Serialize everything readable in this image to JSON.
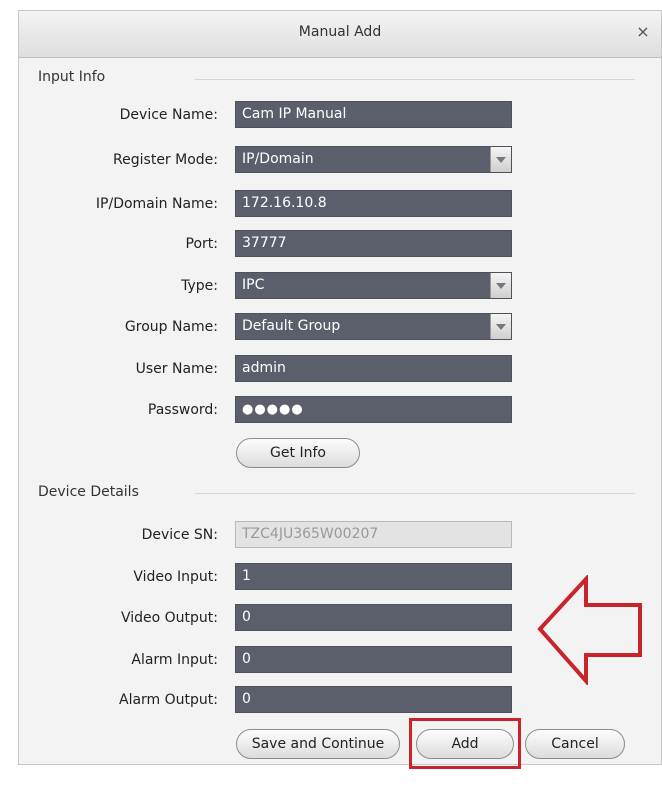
{
  "dialog": {
    "title": "Manual Add",
    "close_glyph": "×"
  },
  "sections": {
    "input_info": "Input Info",
    "device_details": "Device Details"
  },
  "input_info": {
    "device_name": {
      "label": "Device Name:",
      "value": "Cam IP Manual"
    },
    "register_mode": {
      "label": "Register Mode:",
      "value": "IP/Domain"
    },
    "ip_domain_name": {
      "label": "IP/Domain Name:",
      "value": "172.16.10.8"
    },
    "port": {
      "label": "Port:",
      "value": "37777"
    },
    "type": {
      "label": "Type:",
      "value": "IPC"
    },
    "group_name": {
      "label": "Group Name:",
      "value": "Default Group"
    },
    "user_name": {
      "label": "User Name:",
      "value": "admin"
    },
    "password": {
      "label": "Password:",
      "value": "●●●●●"
    },
    "get_info_button": "Get Info"
  },
  "device_details": {
    "device_sn": {
      "label": "Device SN:",
      "value": "TZC4JU365W00207"
    },
    "video_input": {
      "label": "Video Input:",
      "value": "1"
    },
    "video_output": {
      "label": "Video Output:",
      "value": "0"
    },
    "alarm_input": {
      "label": "Alarm Input:",
      "value": "0"
    },
    "alarm_output": {
      "label": "Alarm Output:",
      "value": "0"
    }
  },
  "buttons": {
    "save_and_continue": "Save and Continue",
    "add": "Add",
    "cancel": "Cancel"
  },
  "annotation": {
    "color": "#c8242c",
    "arrow_icon": "left-arrow-outline"
  }
}
